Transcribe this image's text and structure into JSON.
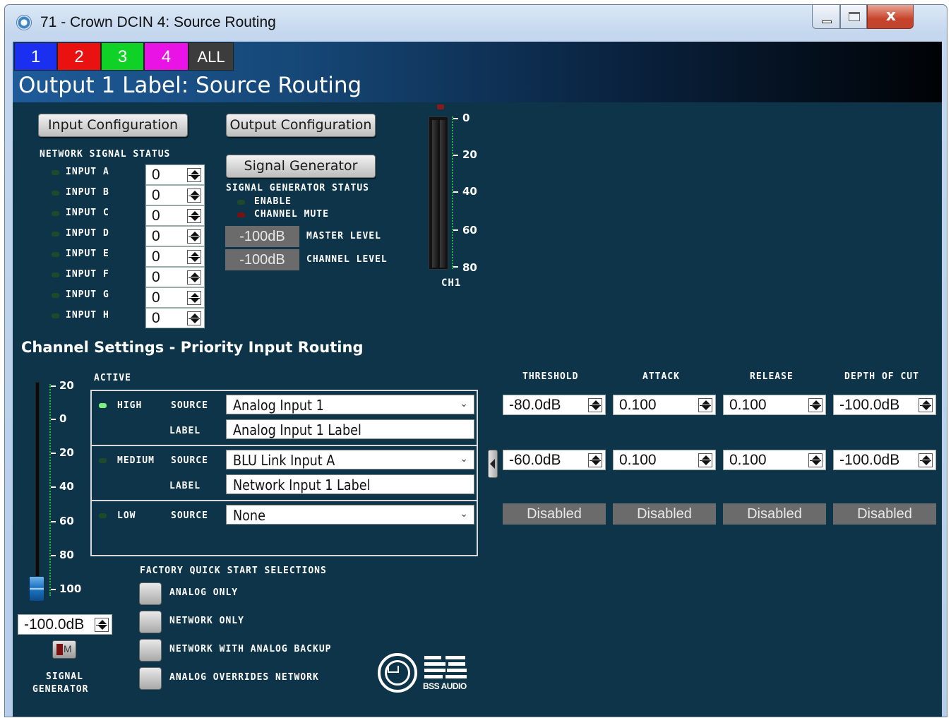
{
  "window": {
    "title": "71 - Crown DCIN 4: Source Routing",
    "close_glyph": "x"
  },
  "tabs": [
    "1",
    "2",
    "3",
    "4",
    "ALL"
  ],
  "page_title": "Output 1 Label: Source Routing",
  "buttons": {
    "input_config": "Input Configuration",
    "output_config": "Output Configuration",
    "signal_generator": "Signal Generator"
  },
  "network_signal_status": {
    "heading": "NETWORK SIGNAL STATUS",
    "inputs": [
      {
        "label": "INPUT A",
        "value": "0"
      },
      {
        "label": "INPUT B",
        "value": "0"
      },
      {
        "label": "INPUT C",
        "value": "0"
      },
      {
        "label": "INPUT D",
        "value": "0"
      },
      {
        "label": "INPUT E",
        "value": "0"
      },
      {
        "label": "INPUT F",
        "value": "0"
      },
      {
        "label": "INPUT G",
        "value": "0"
      },
      {
        "label": "INPUT H",
        "value": "0"
      }
    ]
  },
  "signal_generator_status": {
    "heading": "SIGNAL GENERATOR STATUS",
    "enable": "ENABLE",
    "channel_mute": "CHANNEL MUTE",
    "master_level_value": "-100dB",
    "master_level_label": "MASTER LEVEL",
    "channel_level_value": "-100dB",
    "channel_level_label": "CHANNEL LEVEL"
  },
  "meter": {
    "ticks": [
      "0",
      "20",
      "40",
      "60",
      "80"
    ],
    "label": "CH1"
  },
  "section_title": "Channel Settings - Priority Input Routing",
  "routing": {
    "active_header": "ACTIVE",
    "source_label": "SOURCE",
    "label_label": "LABEL",
    "high": {
      "name": "HIGH",
      "source": "Analog Input 1",
      "label": "Analog Input 1 Label"
    },
    "medium": {
      "name": "MEDIUM",
      "source": "BLU Link Input A",
      "label": "Network Input 1 Label"
    },
    "low": {
      "name": "LOW",
      "source": "None"
    }
  },
  "dynamics": {
    "headers": [
      "THRESHOLD",
      "ATTACK",
      "RELEASE",
      "DEPTH OF CUT"
    ],
    "high": [
      "-80.0dB",
      "0.100",
      "0.100",
      "-100.0dB"
    ],
    "medium": [
      "-60.0dB",
      "0.100",
      "0.100",
      "-100.0dB"
    ],
    "low": [
      "Disabled",
      "Disabled",
      "Disabled",
      "Disabled"
    ]
  },
  "fader": {
    "ticks": [
      "20",
      "0",
      "20",
      "40",
      "60",
      "80",
      "100"
    ],
    "value": "-100.0dB",
    "mute_glyph": "M",
    "label_line1": "SIGNAL",
    "label_line2": "GENERATOR"
  },
  "quick_start": {
    "heading": "FACTORY QUICK START SELECTIONS",
    "options": [
      "ANALOG ONLY",
      "NETWORK ONLY",
      "NETWORK WITH ANALOG BACKUP",
      "ANALOG OVERRIDES NETWORK"
    ]
  },
  "logo": {
    "bss_text": "BSS AUDIO"
  }
}
